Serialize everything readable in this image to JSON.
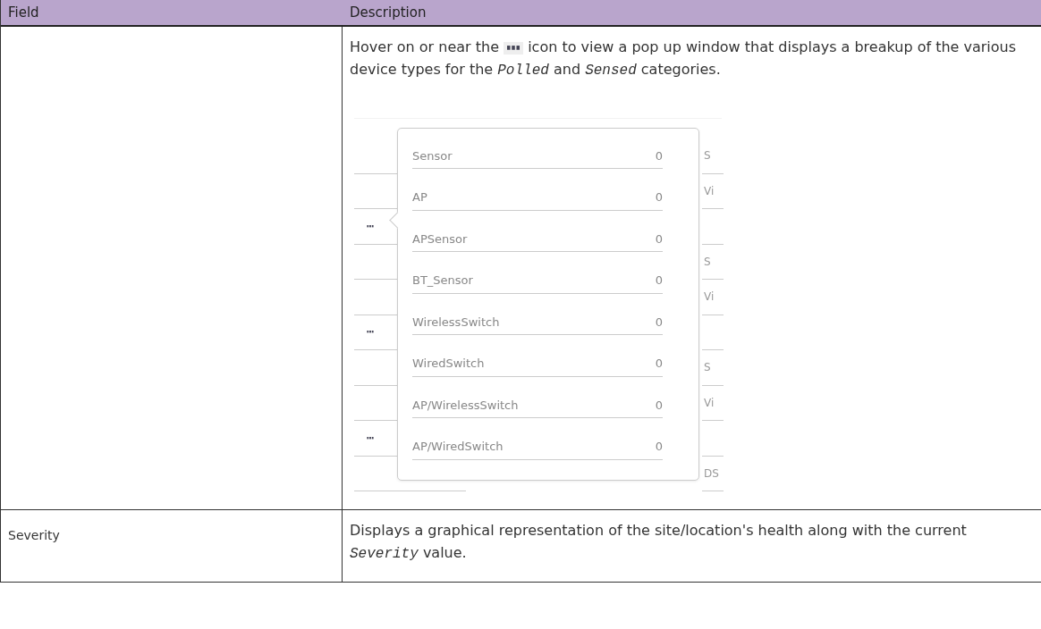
{
  "table": {
    "columns": [
      "Field",
      "Description"
    ],
    "rows": [
      {
        "field": "",
        "description_before_icon": "Hover on or near the",
        "description_after_icon": "icon to view a pop up window that displays a breakup of the various device types for the *Polled* and *Sensed* categories.",
        "figure": {
          "background_rows": [
            {
              "dots": false,
              "fragment": "S"
            },
            {
              "dots": false,
              "fragment": "Vi"
            },
            {
              "dots": true,
              "fragment": ""
            },
            {
              "dots": false,
              "fragment": "S"
            },
            {
              "dots": false,
              "fragment": "Vi"
            },
            {
              "dots": true,
              "fragment": ""
            },
            {
              "dots": false,
              "fragment": "S"
            },
            {
              "dots": false,
              "fragment": "Vi"
            },
            {
              "dots": true,
              "fragment": ""
            },
            {
              "dots": false,
              "fragment": "DS"
            }
          ],
          "popup": [
            {
              "label": "Sensor",
              "count": "0"
            },
            {
              "label": "AP",
              "count": "0"
            },
            {
              "label": "APSensor",
              "count": "0"
            },
            {
              "label": "BT_Sensor",
              "count": "0"
            },
            {
              "label": "WirelessSwitch",
              "count": "0"
            },
            {
              "label": "WiredSwitch",
              "count": "0"
            },
            {
              "label": "AP/WirelessSwitch",
              "count": "0"
            },
            {
              "label": "AP/WiredSwitch",
              "count": "0"
            }
          ]
        }
      },
      {
        "field": "Severity",
        "description": "Displays a graphical representation of the site/location's health along with the current *Severity* value."
      }
    ]
  }
}
